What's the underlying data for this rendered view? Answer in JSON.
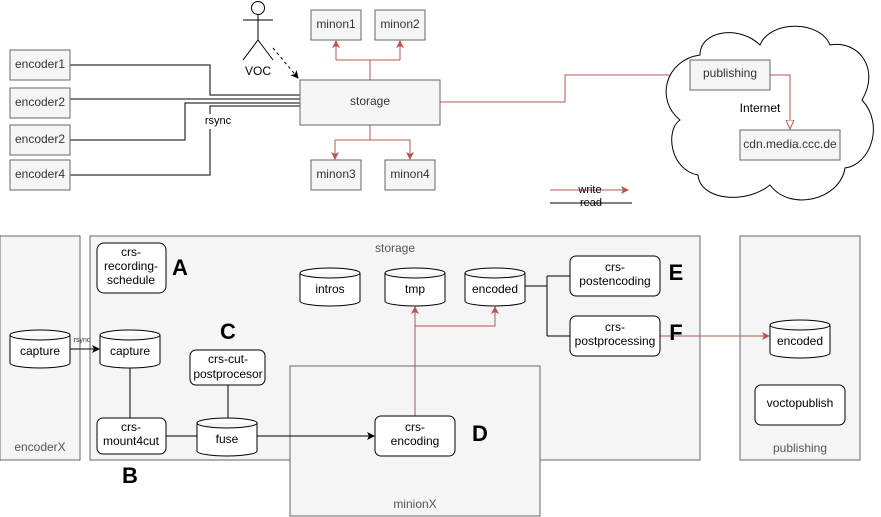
{
  "top": {
    "encoders": [
      "encoder1",
      "encoder2",
      "encoder2",
      "encoder4"
    ],
    "storage": "storage",
    "minions": [
      "minon1",
      "minon2",
      "minon3",
      "minon4"
    ],
    "actor": "VOC",
    "rsync_label": "rsync",
    "publishing": "publishing",
    "cloud_label": "Internet",
    "cdn": "cdn.media.ccc.de",
    "legend": {
      "write": "write",
      "read": "read",
      "write_color": "#b85450",
      "read_color": "#000000"
    }
  },
  "bottom": {
    "panels": {
      "encoderx": "encoderX",
      "storage": "storage",
      "minionx": "minionX",
      "publishing": "publishing"
    },
    "cylinders": {
      "capture_src": "capture",
      "capture": "capture",
      "intros": "intros",
      "tmp": "tmp",
      "encoded": "encoded",
      "fuse": "fuse",
      "encoded_pub": "encoded"
    },
    "services": {
      "recording_schedule": [
        "crs-",
        "recording-",
        "schedule"
      ],
      "cut_postprocesor": [
        "crs-cut-",
        "postprocesor"
      ],
      "mount4cut": [
        "crs-",
        "mount4cut"
      ],
      "encoding": [
        "crs-",
        "encoding"
      ],
      "postencoding": [
        "crs-",
        "postencoding"
      ],
      "postprocessing": [
        "crs-",
        "postprocessing"
      ],
      "voctopublish": "voctopublish"
    },
    "rsync_label": "rsync",
    "markers": [
      "A",
      "B",
      "C",
      "D",
      "E",
      "F"
    ]
  }
}
